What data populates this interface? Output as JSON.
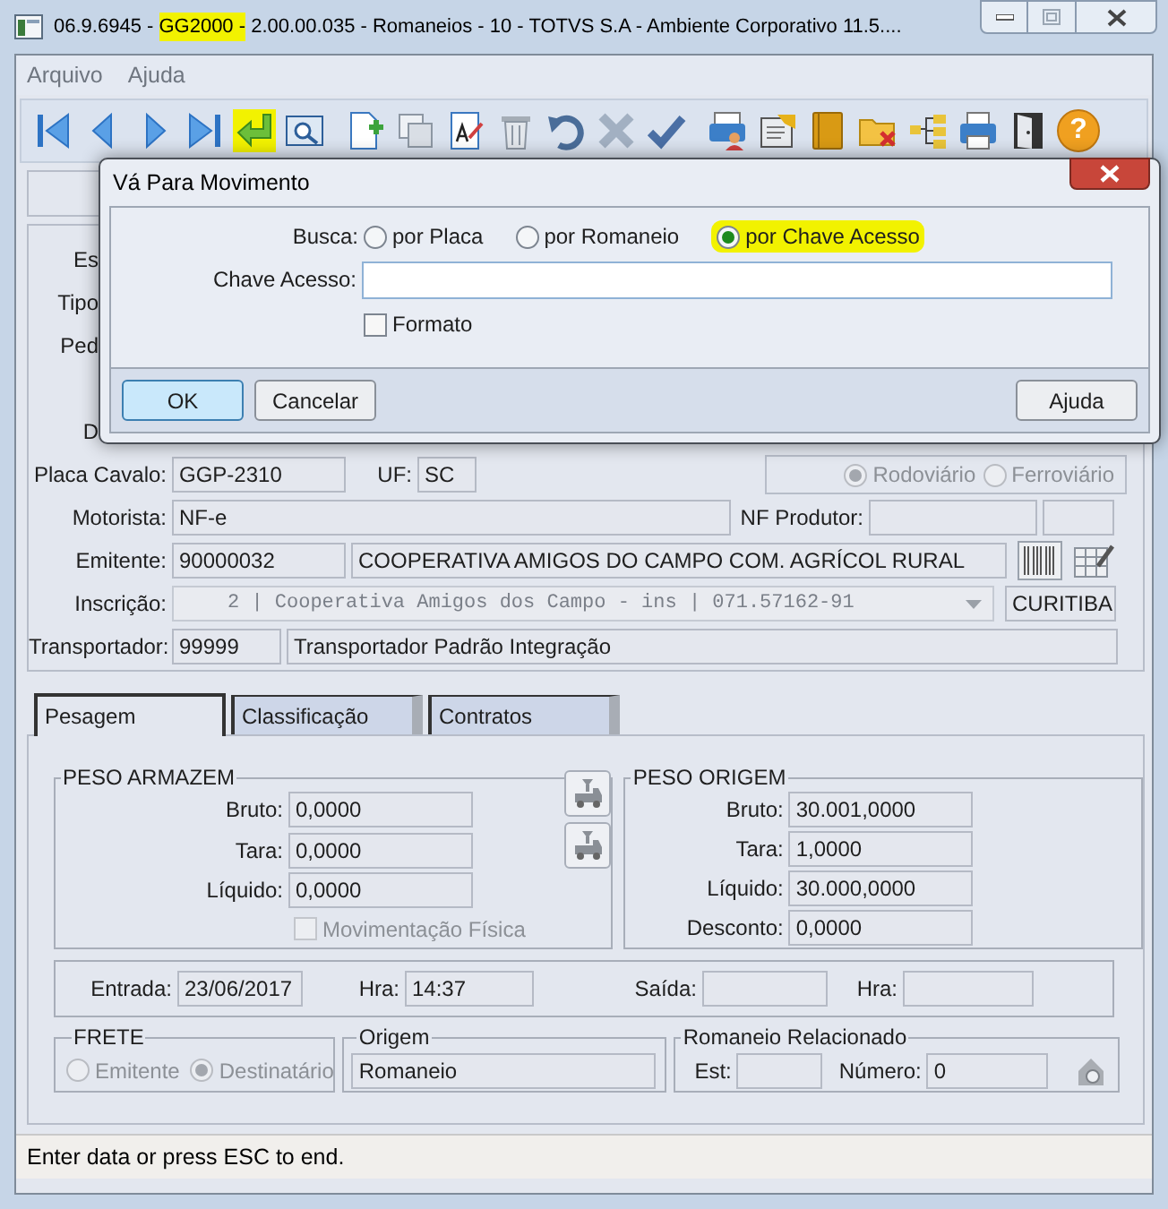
{
  "window": {
    "title_parts": [
      {
        "text": "06.9.6945 - ",
        "highlighted": false
      },
      {
        "text": "GG2000 -",
        "highlighted": true
      },
      {
        "text": " 2.00.00.035 - Romaneios - 10 - TOTVS S.A - Ambiente Corporativo 11.5....",
        "highlighted": false
      }
    ]
  },
  "menu": [
    "Arquivo",
    "Ajuda"
  ],
  "toolbar": [
    [
      {
        "kind": "first",
        "highlighted": false
      },
      {
        "kind": "prev",
        "highlighted": false
      },
      {
        "kind": "next",
        "highlighted": false
      },
      {
        "kind": "last",
        "highlighted": false
      },
      {
        "kind": "goto",
        "highlighted": true
      },
      {
        "kind": "preview",
        "highlighted": false
      }
    ],
    [
      {
        "kind": "new",
        "highlighted": false
      },
      {
        "kind": "copy",
        "highlighted": false
      },
      {
        "kind": "edit",
        "highlighted": false
      },
      {
        "kind": "delete",
        "highlighted": false
      },
      {
        "kind": "undo",
        "highlighted": false
      },
      {
        "kind": "cancel",
        "highlighted": false
      },
      {
        "kind": "confirm",
        "highlighted": false
      }
    ],
    [
      {
        "kind": "print_user",
        "highlighted": false
      },
      {
        "kind": "report",
        "highlighted": false
      },
      {
        "kind": "book",
        "highlighted": false
      },
      {
        "kind": "folder_x",
        "highlighted": false
      },
      {
        "kind": "tree",
        "highlighted": false
      },
      {
        "kind": "print",
        "highlighted": false
      },
      {
        "kind": "exit",
        "highlighted": false
      },
      {
        "kind": "help",
        "highlighted": false,
        "glyph": "?"
      }
    ]
  ],
  "form": {
    "partial_labels": [
      "Es",
      "Tipo",
      "Ped",
      "D"
    ],
    "placa_cavalo": {
      "label": "Placa Cavalo:",
      "value": "GGP-2310"
    },
    "uf": {
      "label": "UF:",
      "value": "SC"
    },
    "modalidade": {
      "disabled": true,
      "options": [
        {
          "label": "Rodoviário",
          "selected": true
        },
        {
          "label": "Ferroviário",
          "selected": false
        }
      ]
    },
    "motorista": {
      "label": "Motorista:",
      "value": "NF-e"
    },
    "nf_produtor": {
      "label": "NF Produtor:"
    },
    "emitente": {
      "label": "Emitente:",
      "code": "90000032",
      "name": "COOPERATIVA AMIGOS DO CAMPO COM. AGRÍCOL RURAL"
    },
    "inscricao": {
      "label": "Inscrição:",
      "value": "2 | Cooperativa Amigos dos Campo - ins | 071.57162-91",
      "city": "CURITIBA"
    },
    "transportador": {
      "label": "Transportador:",
      "code": "99999",
      "name": "Transportador Padrão Integração"
    }
  },
  "tabs": [
    {
      "label": "Pesagem",
      "selected": true
    },
    {
      "label": "Classificação",
      "selected": false
    },
    {
      "label": "Contratos",
      "selected": false
    }
  ],
  "peso_armazem": {
    "title": "PESO ARMAZEM",
    "fields": [
      {
        "label": "Bruto:",
        "value": "0,0000"
      },
      {
        "label": "Tara:",
        "value": "0,0000"
      },
      {
        "label": "Líquido:",
        "value": "0,0000"
      }
    ],
    "movimentacao": {
      "label": "Movimentação Física",
      "checked": false,
      "disabled": true
    }
  },
  "peso_origem": {
    "title": "PESO ORIGEM",
    "fields": [
      {
        "label": "Bruto:",
        "value": "30.001,0000"
      },
      {
        "label": "Tara:",
        "value": "1,0000"
      },
      {
        "label": "Líquido:",
        "value": "30.000,0000"
      },
      {
        "label": "Desconto:",
        "value": "0,0000"
      }
    ]
  },
  "datas": [
    {
      "label": "Entrada:",
      "value": "23/06/2017"
    },
    {
      "label": "Hra:",
      "value": "14:37"
    },
    {
      "label": "Saída:"
    },
    {
      "label": "Hra:"
    }
  ],
  "frete": {
    "title": "FRETE",
    "disabled": true,
    "options": [
      {
        "label": "Emitente",
        "selected": false
      },
      {
        "label": "Destinatário",
        "selected": true
      }
    ]
  },
  "origem": {
    "title": "Origem",
    "value": "Romaneio"
  },
  "romaneio_relacionado": {
    "title": "Romaneio Relacionado",
    "est_label": "Est:",
    "numero_label": "Número:",
    "numero": "0"
  },
  "status_bar": "Enter data or press ESC to end.",
  "dialog": {
    "title": "Vá Para Movimento",
    "busca_label": "Busca:",
    "options": [
      {
        "label": "por Placa",
        "selected": false,
        "highlighted": false
      },
      {
        "label": "por Romaneio",
        "selected": false,
        "highlighted": false
      },
      {
        "label": "por Chave Acesso",
        "selected": true,
        "highlighted": true
      }
    ],
    "chave_label": "Chave Acesso:",
    "formato": {
      "label": "Formato",
      "checked": false,
      "disabled": false
    },
    "buttons_left": [
      {
        "label": "OK",
        "focused": true
      },
      {
        "label": "Cancelar",
        "focused": false
      }
    ],
    "buttons_right": [
      {
        "label": "Ajuda",
        "focused": false
      }
    ]
  }
}
